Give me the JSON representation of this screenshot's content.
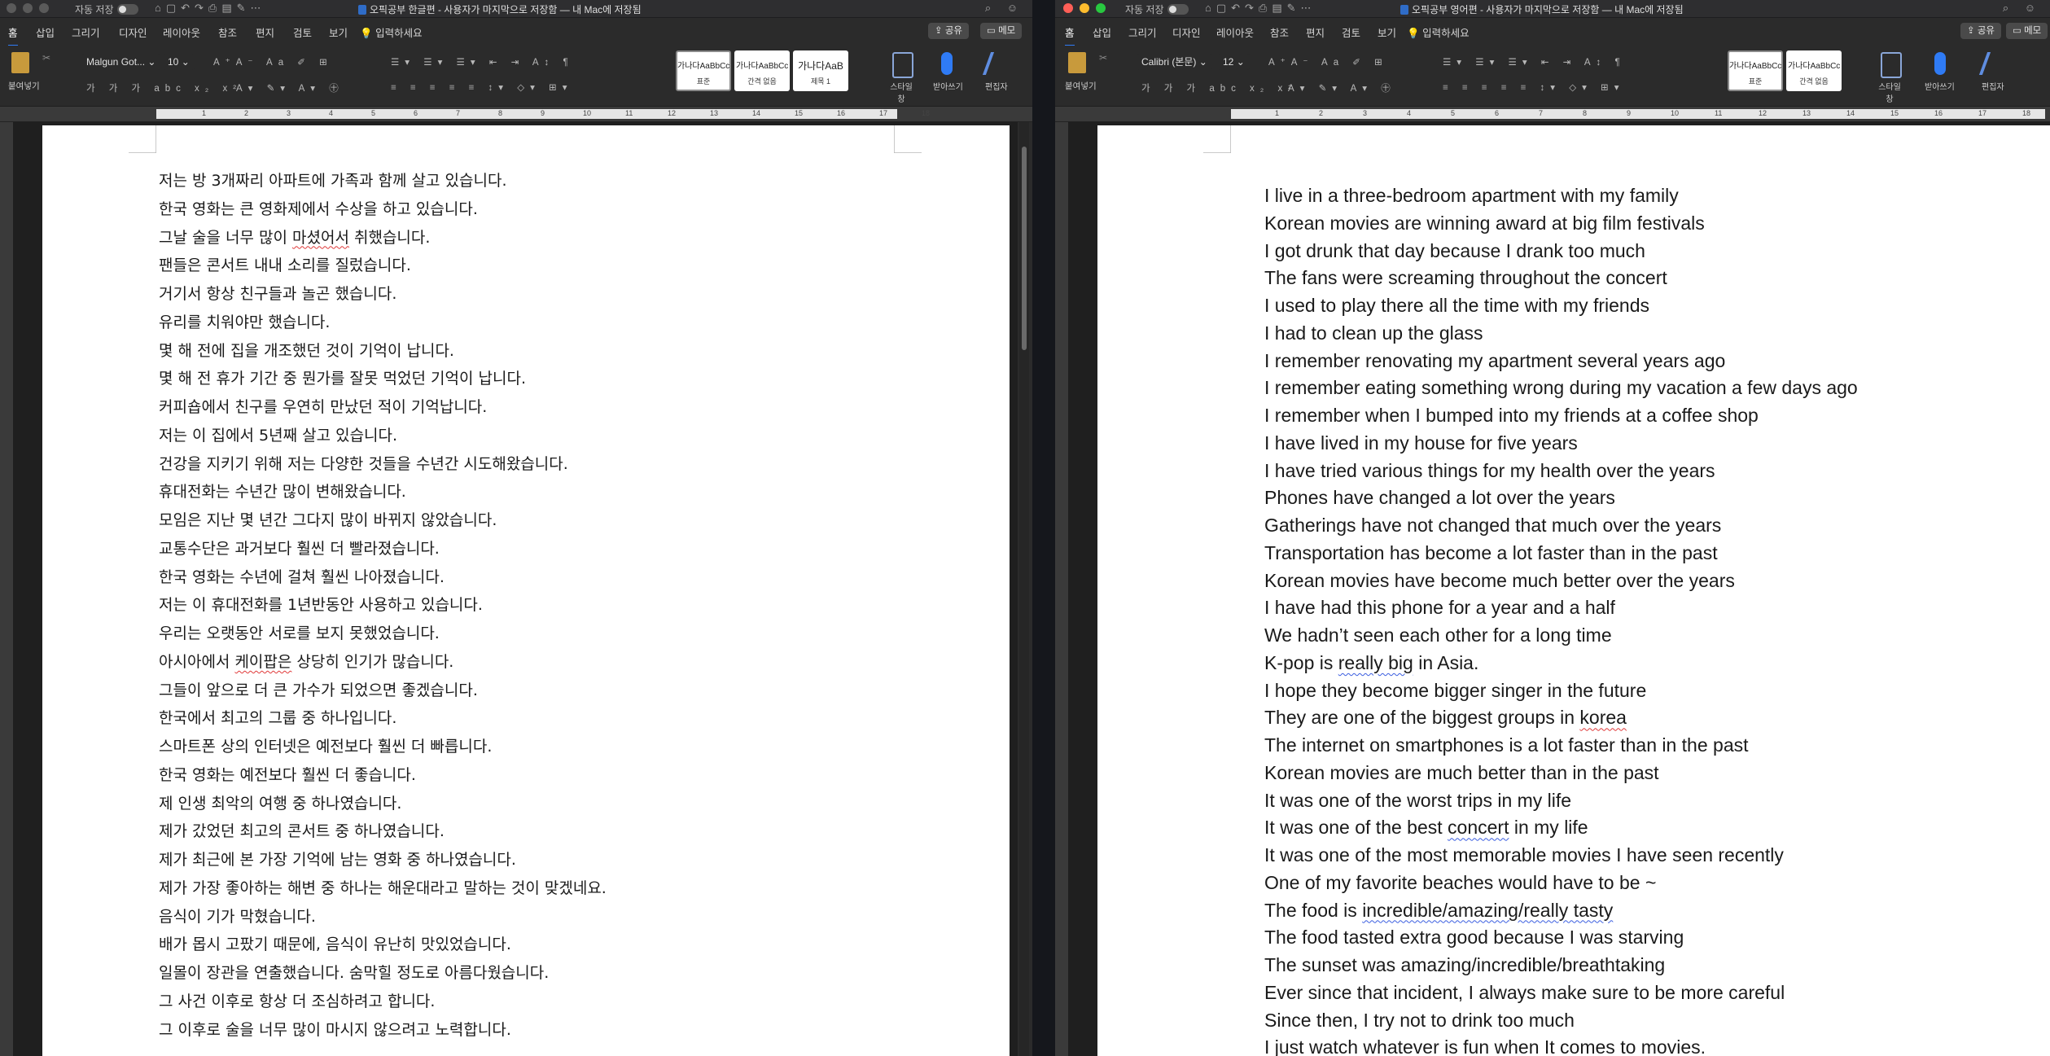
{
  "left": {
    "title": "오픽공부 한글편 - 사용자가 마지막으로 저장함 — 내 Mac에 저장됨",
    "autosave_label": "자동 저장",
    "tabs": [
      "홈",
      "삽입",
      "그리기",
      "디자인",
      "레이아웃",
      "참조",
      "편지",
      "검토",
      "보기"
    ],
    "search_label": "입력하세요",
    "share_label": "공유",
    "memo_label": "메모",
    "paste_label": "붙여넣기",
    "font_name": "Malgun Got...",
    "font_size": "10",
    "styles": [
      {
        "sample": "가나다AaBbCc",
        "label": "표준"
      },
      {
        "sample": "가나다AaBbCc",
        "label": "간격 없음"
      },
      {
        "sample": "가나다AaB",
        "label": "제목 1"
      }
    ],
    "style_pane_label": "스타일 창",
    "dictate_label": "받아쓰기",
    "editor_label": "편집자",
    "lines": [
      {
        "pre": "저는 방 3개짜리 아파트에 가족과 함께 살고 있습니다.",
        "sq": "",
        "post": ""
      },
      {
        "pre": "한국 영화는 큰 영화제에서 수상을 하고 있습니다.",
        "sq": "",
        "post": ""
      },
      {
        "pre": "그날 술을 너무 많이 ",
        "sq": "마셨어서",
        "post": " 취했습니다."
      },
      {
        "pre": "팬들은 콘서트 내내 소리를 질렀습니다.",
        "sq": "",
        "post": ""
      },
      {
        "pre": "거기서 항상 친구들과 놀곤 했습니다.",
        "sq": "",
        "post": ""
      },
      {
        "pre": "유리를 치워야만 했습니다.",
        "sq": "",
        "post": ""
      },
      {
        "pre": "몇 해 전에 집을 개조했던 것이 기억이 납니다.",
        "sq": "",
        "post": ""
      },
      {
        "pre": "몇 해 전 휴가 기간 중 뭔가를 잘못 먹었던 기억이 납니다.",
        "sq": "",
        "post": ""
      },
      {
        "pre": "커피숍에서 친구를 우연히 만났던 적이 기억납니다.",
        "sq": "",
        "post": ""
      },
      {
        "pre": "저는 이 집에서 5년째 살고 있습니다.",
        "sq": "",
        "post": ""
      },
      {
        "pre": "건강을 지키기 위해 저는 다양한 것들을 수년간 시도해왔습니다.",
        "sq": "",
        "post": ""
      },
      {
        "pre": "휴대전화는 수년간 많이 변해왔습니다.",
        "sq": "",
        "post": ""
      },
      {
        "pre": "모임은 지난 몇 년간 그다지 많이 바뀌지 않았습니다.",
        "sq": "",
        "post": ""
      },
      {
        "pre": "교통수단은 과거보다 훨씬 더 빨라졌습니다.",
        "sq": "",
        "post": ""
      },
      {
        "pre": "한국 영화는 수년에 걸쳐 훨씬 나아졌습니다.",
        "sq": "",
        "post": ""
      },
      {
        "pre": "저는 이 휴대전화를 1년반동안 사용하고 있습니다.",
        "sq": "",
        "post": ""
      },
      {
        "pre": "우리는 오랫동안 서로를 보지 못했었습니다.",
        "sq": "",
        "post": ""
      },
      {
        "pre": "아시아에서 ",
        "sq": "케이팝은",
        "post": " 상당히 인기가 많습니다."
      },
      {
        "pre": "그들이 앞으로 더 큰 가수가 되었으면 좋겠습니다.",
        "sq": "",
        "post": ""
      },
      {
        "pre": "한국에서 최고의 그룹 중 하나입니다.",
        "sq": "",
        "post": ""
      },
      {
        "pre": "스마트폰 상의 인터넷은 예전보다 훨씬 더 빠릅니다.",
        "sq": "",
        "post": ""
      },
      {
        "pre": "한국 영화는 예전보다 훨씬 더 좋습니다.",
        "sq": "",
        "post": ""
      },
      {
        "pre": "제 인생 최악의 여행 중 하나였습니다.",
        "sq": "",
        "post": ""
      },
      {
        "pre": "제가 갔었던 최고의 콘서트 중 하나였습니다.",
        "sq": "",
        "post": ""
      },
      {
        "pre": "제가 최근에 본 가장 기억에 남는 영화 중 하나였습니다.",
        "sq": "",
        "post": ""
      },
      {
        "pre": "제가 가장 좋아하는 해변 중 하나는 해운대라고 말하는 것이 맞겠네요.",
        "sq": "",
        "post": ""
      },
      {
        "pre": "음식이 기가 막혔습니다.",
        "sq": "",
        "post": ""
      },
      {
        "pre": "배가 몹시 고팠기 때문에, 음식이 유난히 맛있었습니다.",
        "sq": "",
        "post": ""
      },
      {
        "pre": "일몰이 장관을 연출했습니다. 숨막힐 정도로 아름다웠습니다.",
        "sq": "",
        "post": ""
      },
      {
        "pre": "그 사건 이후로 항상 더 조심하려고 합니다.",
        "sq": "",
        "post": ""
      },
      {
        "pre": "그 이후로 술을 너무 많이 마시지 않으려고 노력합니다.",
        "sq": "",
        "post": ""
      }
    ]
  },
  "right": {
    "title": "오픽공부 영어편 - 사용자가 마지막으로 저장함 — 내 Mac에 저장됨",
    "autosave_label": "자동 저장",
    "tabs": [
      "홈",
      "삽입",
      "그리기",
      "디자인",
      "레이아웃",
      "참조",
      "편지",
      "검토",
      "보기"
    ],
    "search_label": "입력하세요",
    "share_label": "공유",
    "memo_label": "메모",
    "paste_label": "붙여넣기",
    "font_name": "Calibri (본문)",
    "font_size": "12",
    "styles": [
      {
        "sample": "가나다AaBbCc",
        "label": "표준"
      },
      {
        "sample": "가나다AaBbCc",
        "label": "간격 없음"
      }
    ],
    "style_pane_label": "스타일 창",
    "dictate_label": "받아쓰기",
    "editor_label": "편집자",
    "lines": [
      {
        "pre": "I live in a three-bedroom apartment with my family",
        "sq": "",
        "post": "",
        "sqtype": ""
      },
      {
        "pre": "Korean movies are winning award at big film festivals",
        "sq": "",
        "post": "",
        "sqtype": ""
      },
      {
        "pre": "I got drunk that day because I drank too much",
        "sq": "",
        "post": "",
        "sqtype": ""
      },
      {
        "pre": "The fans were screaming throughout the concert",
        "sq": "",
        "post": "",
        "sqtype": ""
      },
      {
        "pre": "I used to play there all the time with my friends",
        "sq": "",
        "post": "",
        "sqtype": ""
      },
      {
        "pre": "I had to clean up the glass",
        "sq": "",
        "post": "",
        "sqtype": ""
      },
      {
        "pre": "I remember renovating my apartment several years ago",
        "sq": "",
        "post": "",
        "sqtype": ""
      },
      {
        "pre": "I remember eating something wrong during my vacation a few days ago",
        "sq": "",
        "post": "",
        "sqtype": ""
      },
      {
        "pre": "I remember when I bumped into my friends at a coffee shop",
        "sq": "",
        "post": "",
        "sqtype": ""
      },
      {
        "pre": "I have lived in my house for five years",
        "sq": "",
        "post": "",
        "sqtype": ""
      },
      {
        "pre": "I have tried various things for my health over the years",
        "sq": "",
        "post": "",
        "sqtype": ""
      },
      {
        "pre": "Phones have changed a lot over the years",
        "sq": "",
        "post": "",
        "sqtype": ""
      },
      {
        "pre": "Gatherings have not changed that much over the years",
        "sq": "",
        "post": "",
        "sqtype": ""
      },
      {
        "pre": "Transportation has become a lot faster than in the past",
        "sq": "",
        "post": "",
        "sqtype": ""
      },
      {
        "pre": "Korean movies have become much better over the years",
        "sq": "",
        "post": "",
        "sqtype": ""
      },
      {
        "pre": "I have had this phone for a year and a half",
        "sq": "",
        "post": "",
        "sqtype": ""
      },
      {
        "pre": "We hadn’t seen each other for a long time",
        "sq": "",
        "post": "",
        "sqtype": ""
      },
      {
        "pre": "K-pop is ",
        "sq": "really big",
        "post": " in Asia.",
        "sqtype": "blue"
      },
      {
        "pre": "I hope they become bigger singer in the future",
        "sq": "",
        "post": "",
        "sqtype": ""
      },
      {
        "pre": "They are one of the biggest groups in ",
        "sq": "korea",
        "post": "",
        "sqtype": "red"
      },
      {
        "pre": "The internet on smartphones is a lot faster than in the past",
        "sq": "",
        "post": "",
        "sqtype": ""
      },
      {
        "pre": "Korean movies are much better than in the past",
        "sq": "",
        "post": "",
        "sqtype": ""
      },
      {
        "pre": "It was one of the worst trips in my life",
        "sq": "",
        "post": "",
        "sqtype": ""
      },
      {
        "pre": "It was one of the best ",
        "sq": "concert",
        "post": " in my life",
        "sqtype": "blue"
      },
      {
        "pre": "It was one of the most memorable movies I have seen recently",
        "sq": "",
        "post": "",
        "sqtype": ""
      },
      {
        "pre": "One of my favorite beaches would have to be ~",
        "sq": "",
        "post": "",
        "sqtype": ""
      },
      {
        "pre": "The food is ",
        "sq": "incredible/amazing/really tasty",
        "post": "",
        "sqtype": "blue"
      },
      {
        "pre": "The food tasted extra good because I was starving",
        "sq": "",
        "post": "",
        "sqtype": ""
      },
      {
        "pre": "The sunset was amazing/incredible/breathtaking",
        "sq": "",
        "post": "",
        "sqtype": ""
      },
      {
        "pre": "Ever since that incident, I always make sure to be more careful",
        "sq": "",
        "post": "",
        "sqtype": ""
      },
      {
        "pre": "Since then, I try not to drink too much",
        "sq": "",
        "post": "",
        "sqtype": ""
      },
      {
        "pre": "I just watch whatever is fun when It comes to movies.",
        "sq": "",
        "post": "",
        "sqtype": ""
      }
    ]
  },
  "ruler_numbers": [
    "1",
    "2",
    "3",
    "4",
    "5",
    "6",
    "7",
    "8",
    "9",
    "10",
    "11",
    "12",
    "13",
    "14",
    "15",
    "16",
    "17",
    "18"
  ],
  "colors": {
    "accent": "#2f7bf5",
    "close": "#ff5f57",
    "minimize": "#febc2e",
    "zoom": "#28c840",
    "page": "#ffffff",
    "spell_red": "#e03a3a",
    "grammar_blue": "#3b5ee0"
  }
}
